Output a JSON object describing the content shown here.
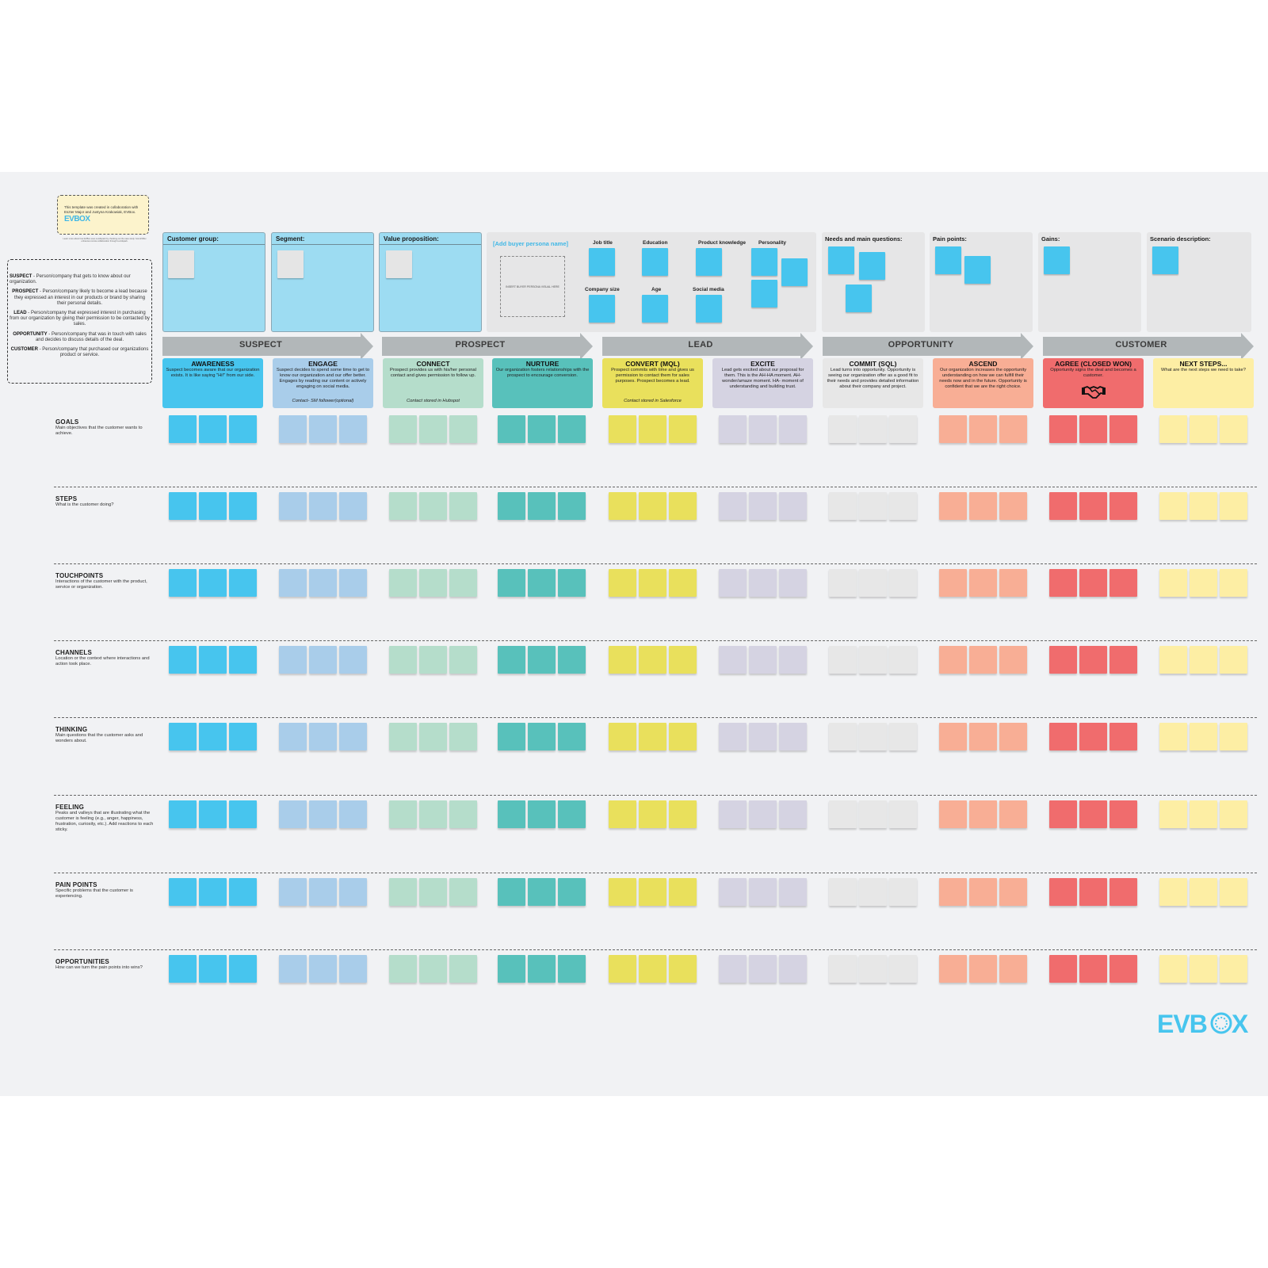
{
  "credit": {
    "text": "This template was created in collaboration with Eszter Major and Justyna Krakowiak, EVBox.",
    "brand": "EVBOX",
    "caption": "Learn more about how EVBox uses Lucidspark by checking out the case study: how EVBox enhances remote collaboration through Lucidspark."
  },
  "glossary": [
    {
      "term": "SUSPECT",
      "def": " - Person/company that gets to know about our organization."
    },
    {
      "term": "PROSPECT",
      "def": " - Person/company likely to become a lead because they expressed an interest in our products or brand by sharing their personal details."
    },
    {
      "term": "LEAD",
      "def": " - Person/company that expressed interest in purchasing from our organization by giving their permission to be contacted by sales."
    },
    {
      "term": "OPPORTUNITY",
      "def": " - Person/company that was in touch with sales and decides to discuss details of the deal."
    },
    {
      "term": "CUSTOMER",
      "def": " - Person/company that purchased our organizations product or service."
    }
  ],
  "top_panels": {
    "customer_group": "Customer group:",
    "segment": "Segment:",
    "value_proposition": "Value proposition:",
    "persona_name": "[Add buyer persona name]",
    "persona_visual": "INSERT BUYER PERSONA VISUAL HERE",
    "persona_attributes": [
      "Job title",
      "Education",
      "Product knowledge",
      "Personality",
      "Company size",
      "Age",
      "Social media"
    ],
    "needs": "Needs and main questions:",
    "pain_points": "Pain points:",
    "gains": "Gains:",
    "scenario": "Scenario description:"
  },
  "stages": [
    "SUSPECT",
    "PROSPECT",
    "LEAD",
    "OPPORTUNITY",
    "CUSTOMER"
  ],
  "phases": [
    {
      "title": "AWARENESS",
      "desc": "Suspect becomes aware that our organization exists. It is like saying \"Hi!\" from our side.",
      "note": "",
      "color": "#47c5ee"
    },
    {
      "title": "ENGAGE",
      "desc": "Suspect decides to spend some time to get to know our organization and our offer better. Engages by reading our content or actively engaging on social media.",
      "note": "Contact- SM follower(optional)",
      "color": "#a9cdea"
    },
    {
      "title": "CONNECT",
      "desc": "Prospect provides us with his/her personal contact and gives permission to follow up.",
      "note": "Contact stored in Hubspot",
      "color": "#b5ddcb"
    },
    {
      "title": "NURTURE",
      "desc": "Our organization fosters relationships with the prospect to encourage conversion.",
      "note": "",
      "color": "#58c1bb"
    },
    {
      "title": "CONVERT (MQL)",
      "desc": "Prospect commits with time and gives us permission to contact them for sales purposes. Prospect becomes a lead.",
      "note": "Contact stored in Salesforce",
      "color": "#e9e05c"
    },
    {
      "title": "EXCITE",
      "desc": "Lead gets excited about our proposal for them. This is the AH-HA moment. AH- wonder/amaze moment. HA- moment of understanding and building trust.",
      "note": "",
      "color": "#d5d3e2"
    },
    {
      "title": "COMMIT (SQL)",
      "desc": "Lead turns into opportunity. Opportunity is seeing our organization offer as a good fit to their needs and provides detailed information about their company and project.",
      "note": "",
      "color": "#e7e7e7"
    },
    {
      "title": "ASCEND",
      "desc": "Our organization increases the opportunity understanding on how we can fulfill their needs now and in the future. Opportunity is confident that we are the right choice.",
      "note": "",
      "color": "#f8ae95"
    },
    {
      "title": "AGREE (CLOSED WON)",
      "desc": "Opportunity signs the deal and becomes a customer.",
      "note": "",
      "color": "#f06c6d",
      "icon": "handshake-icon"
    },
    {
      "title": "NEXT STEPS...",
      "desc": "What are the next steps we need to take?",
      "note": "",
      "color": "#fdeea4"
    }
  ],
  "rows": [
    {
      "title": "GOALS",
      "desc": "Main objectives that the customer wants to achieve."
    },
    {
      "title": "STEPS",
      "desc": "What is the customer doing?"
    },
    {
      "title": "TOUCHPOINTS",
      "desc": "Interactions of the customer with the product, service or organization."
    },
    {
      "title": "CHANNELS",
      "desc": "Location or the context where interactions and action took place."
    },
    {
      "title": "THINKING",
      "desc": "Main questions that the customer asks and wonders about."
    },
    {
      "title": "FEELING",
      "desc": "Peaks and valleys that are illustrating what the customer is feeling (e.g., anger, happiness, frustration, curiosity, etc.). Add reactions to each sticky."
    },
    {
      "title": "PAIN POINTS",
      "desc": "Specific problems that the customer is experiencing."
    },
    {
      "title": "OPPORTUNITIES",
      "desc": "How can we turn the pain points into wins?"
    }
  ],
  "logo": "EVBOX",
  "colors": {
    "board": "#f1f2f4",
    "arrow": "#b2b7b9",
    "accent": "#3fb7e6"
  }
}
